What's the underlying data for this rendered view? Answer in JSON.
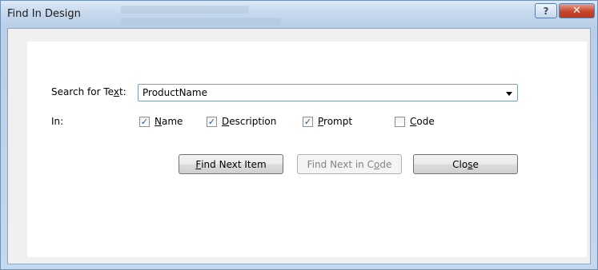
{
  "window": {
    "title": "Find In Design",
    "help_glyph": "?",
    "close_glyph": "✕"
  },
  "search": {
    "label_pre": "Search for Te",
    "label_mnemonic": "x",
    "label_post": "t:",
    "value": "ProductName"
  },
  "in_label": "In:",
  "options": [
    {
      "mnemonic": "N",
      "rest": "ame",
      "checked": true
    },
    {
      "mnemonic": "D",
      "rest": "escription",
      "checked": true
    },
    {
      "mnemonic": "P",
      "rest": "rompt",
      "checked": true
    },
    {
      "mnemonic": "C",
      "rest": "ode",
      "checked": false
    }
  ],
  "check_glyph": "✓",
  "buttons": {
    "find_next": {
      "mnemonic": "F",
      "rest": "ind Next Item"
    },
    "find_next_code": {
      "pre": "Find Next in C",
      "mnemonic": "o",
      "post": "de"
    },
    "close": {
      "pre": "Clo",
      "mnemonic": "s",
      "post": "e"
    }
  },
  "colors": {
    "accent": "#2b5aa5",
    "close_red": "#c7452a",
    "frame": "#b9cfe7"
  }
}
